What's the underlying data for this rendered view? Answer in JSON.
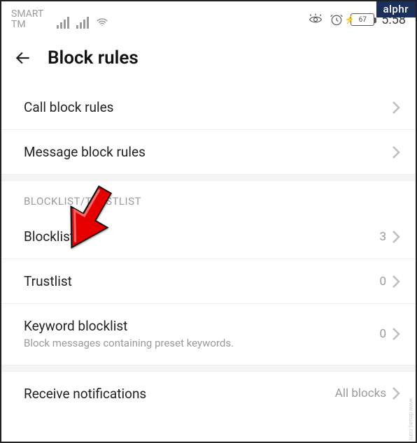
{
  "badge": "alphr",
  "status": {
    "carrier_line1": "SMART",
    "carrier_line2": "TM",
    "battery_pct": "67",
    "time": "5:58"
  },
  "header": {
    "title": "Block rules"
  },
  "rows_top": [
    {
      "label": "Call block rules"
    },
    {
      "label": "Message block rules"
    }
  ],
  "section_title": "BLOCKLIST/TRUSTLIST",
  "rows_lists": [
    {
      "label": "Blocklist",
      "value": "3"
    },
    {
      "label": "Trustlist",
      "value": "0"
    },
    {
      "label": "Keyword blocklist",
      "sub": "Block messages containing preset keywords.",
      "value": "0"
    }
  ],
  "rows_bottom": [
    {
      "label": "Receive notifications",
      "value": "All blocks"
    }
  ],
  "watermark": "www.deuaq.com"
}
